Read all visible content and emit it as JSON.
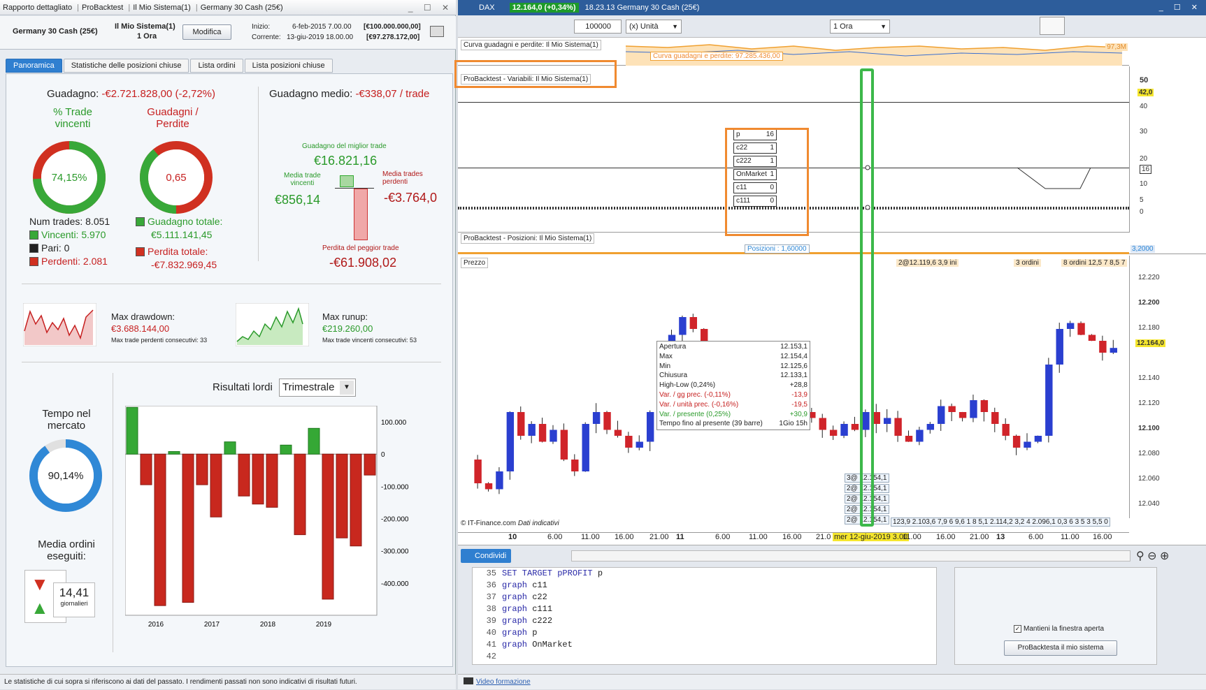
{
  "left": {
    "window_title_parts": [
      "Rapporto dettagliato",
      "ProBacktest",
      "Il Mio Sistema(1)",
      "Germany 30 Cash (25€)"
    ],
    "instrument": "Germany 30 Cash (25€)",
    "system": "Il Mio Sistema(1)",
    "timeframe": "1 Ora",
    "modify_label": "Modifica",
    "start_label": "Inizio:",
    "start_date": "6-feb-2015 7.00.00",
    "start_value": "[€100.000.000,00]",
    "current_label": "Corrente:",
    "current_date": "13-giu-2019 18.00.00",
    "current_value": "[€97.278.172,00]",
    "tabs": [
      "Panoramica",
      "Statistiche delle posizioni chiuse",
      "Lista ordini",
      "Lista posizioni chiuse"
    ],
    "gain_label": "Guadagno:",
    "gain_value": "-€2.721.828,00 (-2,72%)",
    "avg_gain_label": "Guadagno medio:",
    "avg_gain_value": "-€338,07 / trade",
    "win_pct_title_1": "% Trade",
    "win_pct_title_2": "vincenti",
    "win_pct": "74,15%",
    "win_pct_num": 74.15,
    "gp_title_1": "Guadagni /",
    "gp_title_2": "Perdite",
    "gp_ratio": "0,65",
    "num_trades": "Num trades: 8.051",
    "winners": "Vincenti: 5.970",
    "even": "Pari: 0",
    "losers": "Perdenti: 2.081",
    "total_gain_label": "Guadagno totale:",
    "total_gain": "€5.111.141,45",
    "total_loss_label": "Perdita totale:",
    "total_loss": "-€7.832.969,45",
    "best_trade_label": "Guadagno del miglior trade",
    "best_trade": "€16.821,16",
    "avg_win_label_1": "Media trade",
    "avg_win_label_2": "vincenti",
    "avg_win": "€856,14",
    "avg_loss_label_1": "Media trades",
    "avg_loss_label_2": "perdenti",
    "avg_loss": "-€3.764,0",
    "worst_trade_label": "Perdita del peggior trade",
    "worst_trade": "-€61.908,02",
    "max_dd_label": "Max drawdown:",
    "max_dd": "€3.688.144,00",
    "max_loss_consec": "Max trade perdenti consecutivi: 33",
    "max_runup_label": "Max runup:",
    "max_runup": "€219.260,00",
    "max_win_consec": "Max trade vincenti consecutivi: 53",
    "results_label": "Risultati lordi",
    "results_select": "Trimestrale",
    "time_in_market_1": "Tempo nel",
    "time_in_market_2": "mercato",
    "time_in_market": "90,14%",
    "time_in_market_num": 90.14,
    "avg_orders_1": "Media ordini",
    "avg_orders_2": "eseguiti:",
    "avg_orders": "14,41",
    "avg_orders_unit": "giornalieri",
    "disclaimer": "Le statistiche di cui sopra si riferiscono ai dati del passato. I rendimenti passati non sono indicativi di risultati futuri."
  },
  "chart_data": {
    "type": "bar",
    "title": "Risultati lordi",
    "x_ticks": [
      "2016",
      "2017",
      "2018",
      "2019"
    ],
    "y_ticks": [
      "100.000",
      "0",
      "-100.000",
      "-200.000",
      "-300.000",
      "-400.000"
    ],
    "ylim": [
      -500000,
      150000
    ],
    "values": [
      145000,
      -95000,
      -470000,
      8000,
      -460000,
      -95000,
      -195000,
      38000,
      -130000,
      -155000,
      -165000,
      28000,
      -250000,
      80000,
      -450000,
      -260000,
      -285000,
      -65000
    ],
    "colors": {
      "positive": "#35a835",
      "negative": "#c8281e"
    }
  },
  "right": {
    "title_symbol": "DAX",
    "price_badge": "12.164,0 (+0,34%)",
    "title_info": "18.23.13 Germany 30 Cash (25€)",
    "qty": "100000",
    "unit_select": "(x) Unità",
    "tf_select": "1 Ora",
    "equity_title": "Curva guadagni e perdite: Il Mio Sistema(1)",
    "equity_tag": "Curva guadagni e perdite: 97.285.436,00",
    "equity_axis": "97,3M",
    "vars_title": "ProBacktest - Variabili: Il Mio Sistema(1)",
    "vars_axis": [
      "50",
      "40",
      "30",
      "20",
      "16",
      "10",
      "5",
      "0"
    ],
    "vars_current": "42,0",
    "vars": [
      {
        "name": "p",
        "v": "16"
      },
      {
        "name": "c22",
        "v": "1"
      },
      {
        "name": "c222",
        "v": "1"
      },
      {
        "name": "OnMarket",
        "v": "1"
      },
      {
        "name": "c11",
        "v": "0"
      },
      {
        "name": "c111",
        "v": "0"
      }
    ],
    "pos_title": "ProBacktest - Posizioni: Il Mio Sistema(1)",
    "pos_tag": "Posizioni : 1,60000",
    "pos_axis": "3,2000",
    "price_title": "Prezzo",
    "price_axis": [
      "12.220",
      "12.200",
      "12.180",
      "12.164,0",
      "12.140",
      "12.120",
      "12.100",
      "12.080",
      "12.060",
      "12.040"
    ],
    "order_tags": [
      "2@12.119,6  3,9 ini",
      "3 ordini",
      "8 ordini  12,5  7  8,5  7"
    ],
    "tooltip": [
      [
        "Apertura",
        "12.153,1"
      ],
      [
        "Max",
        "12.154,4"
      ],
      [
        "Min",
        "12.125,6"
      ],
      [
        "Chiusura",
        "12.133,1"
      ],
      [
        "High-Low (0,24%)",
        "+28,8"
      ],
      [
        "Var. / gg prec. (-0,11%)",
        "-13,9"
      ],
      [
        "Var. / unità prec. (-0,16%)",
        "-19,5"
      ],
      [
        "Var. / presente (0,25%)",
        "+30,9"
      ],
      [
        "Tempo fino al presente (39 barre)",
        "1Gio 15h"
      ]
    ],
    "fills": [
      "3@ 12.154,1",
      "2@ 12.154,1",
      "2@ 12.154,1",
      "2@ 12.154,1",
      "2@ 12.154,1"
    ],
    "fill_row": "123,9  2.103,6  7,9  6  9,6  1  8  5,1  2.114,2  3,2  4  2.096,1  0,3  6  3  5  3  5,5  0",
    "credit": "© IT-Finance.com",
    "credit_note": "Dati indicativi",
    "x_axis": [
      "10",
      "6.00",
      "11.00",
      "16.00",
      "21.00",
      "11",
      "6.00",
      "11.00",
      "16.00",
      "21.0",
      "mer 12-giu-2019 3.00",
      "11.00",
      "16.00",
      "21.00",
      "13",
      "6.00",
      "11.00",
      "16.00"
    ],
    "share_label": "Condividi",
    "code_lines": [
      {
        "n": "35",
        "kw": "SET TARGET pPROFIT",
        "rest": " p"
      },
      {
        "n": "36",
        "kw": "graph",
        "rest": " c11"
      },
      {
        "n": "37",
        "kw": "graph",
        "rest": " c22"
      },
      {
        "n": "38",
        "kw": "graph",
        "rest": " c111"
      },
      {
        "n": "39",
        "kw": "graph",
        "rest": " c222"
      },
      {
        "n": "40",
        "kw": "graph",
        "rest": " p"
      },
      {
        "n": "41",
        "kw": "graph",
        "rest": " OnMarket"
      },
      {
        "n": "42",
        "kw": "",
        "rest": ""
      }
    ],
    "keep_open": "Mantieni la finestra aperta",
    "run_btn": "ProBacktesta il mio sistema",
    "video_link": "Video formazione"
  }
}
